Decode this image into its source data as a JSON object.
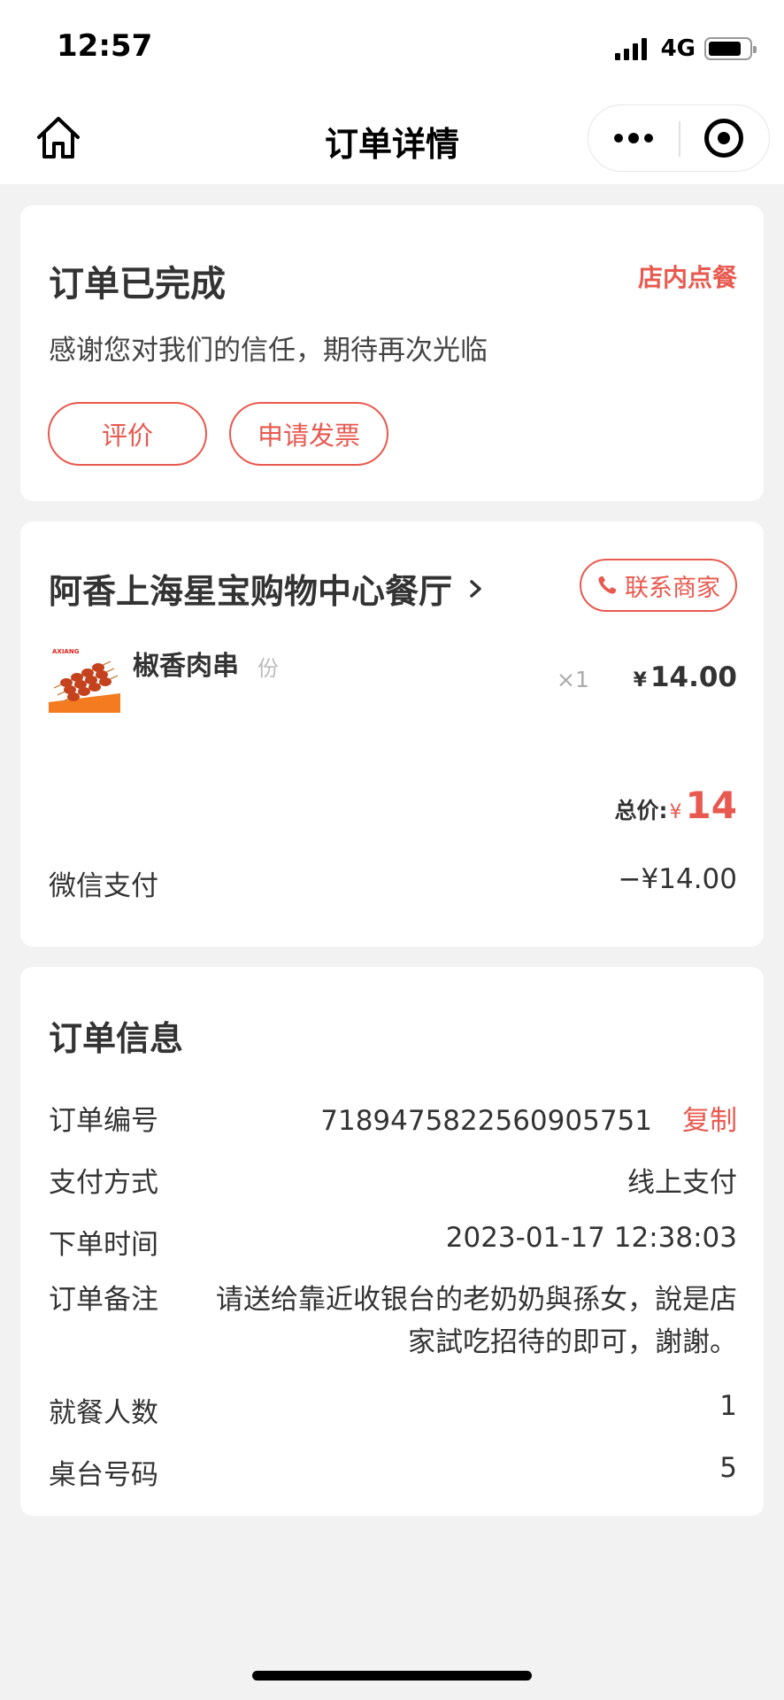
{
  "status_bar": {
    "time": "12:57",
    "network": "4G"
  },
  "nav": {
    "title": "订单详情"
  },
  "status_card": {
    "title": "订单已完成",
    "order_type": "店内点餐",
    "message": "感谢您对我们的信任，期待再次光临",
    "review_label": "评价",
    "invoice_label": "申请发票"
  },
  "order_card": {
    "store_name": "阿香上海星宝购物中心餐厅",
    "contact_label": "联系商家",
    "item": {
      "name": "椒香肉串",
      "unit": "份",
      "qty": "×1",
      "currency": "¥",
      "price": "14.00",
      "thumb_brand": "AXIANG"
    },
    "total_label": "总价:",
    "total_currency": "¥",
    "total_value": "14",
    "payment_method": "微信支付",
    "payment_amount": "−¥14.00"
  },
  "info_card": {
    "title": "订单信息",
    "order_no_label": "订单编号",
    "order_no": "7189475822560905751",
    "copy_label": "复制",
    "pay_type_label": "支付方式",
    "pay_type": "线上支付",
    "time_label": "下单时间",
    "time": "2023-01-17 12:38:03",
    "note_label": "订单备注",
    "note": "请送给靠近收银台的老奶奶與孫女，說是店家試吃招待的即可，謝謝。",
    "diners_label": "就餐人数",
    "diners": "1",
    "table_label": "桌台号码",
    "table": "5"
  },
  "colors": {
    "accent": "#e8594f",
    "background": "#f2f2f2"
  },
  "icons": [
    "home-icon",
    "more-dots-icon",
    "close-target-icon",
    "chevron-right-icon",
    "phone-icon"
  ]
}
